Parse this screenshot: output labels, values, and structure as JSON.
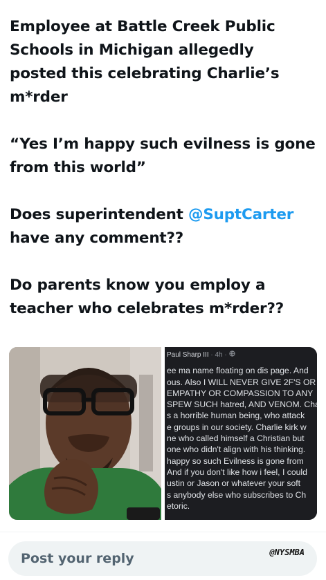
{
  "post": {
    "paragraphs": [
      {
        "lines": [
          "Employee at Battle Creek Public",
          "Schools in Michigan allegedly",
          "posted this celebrating Charlie’s",
          "m*rder"
        ]
      },
      {
        "lines": [
          "“Yes I’m happy such evilness is gone",
          "from this world”"
        ]
      },
      {
        "line1_before": "Does superintendent ",
        "mention": "@SuptCarter",
        "line2": "have any comment??"
      },
      {
        "lines": [
          "Do parents know you employ a",
          "teacher who celebrates m*rder??"
        ]
      }
    ]
  },
  "media": {
    "comment": {
      "author": "Paul Sharp III",
      "meta": " · 4h · ",
      "globe_icon": "globe-icon",
      "lines": [
        "ee ma name floating on dis page. And",
        "ous. Also I WILL NEVER GIVE 2F'S OR",
        "EMPATHY OR COMPASSION TO ANY",
        "SPEW SUCH hatred, AND VENOM. Cha",
        "s a horrible human being, who attack",
        "e groups in our society. Charlie kirk w",
        "ne who called himself a Christian but",
        "one who didn't align with his thinking.",
        " happy so such Evilness is gone from",
        "And if you don't like how i feel, I could",
        "ustin or Jason or whatever your soft",
        "s anybody else who subscribes to Ch",
        "etoric."
      ]
    }
  },
  "reply": {
    "placeholder": "Post your reply",
    "watermark": "@NYSMBA"
  }
}
